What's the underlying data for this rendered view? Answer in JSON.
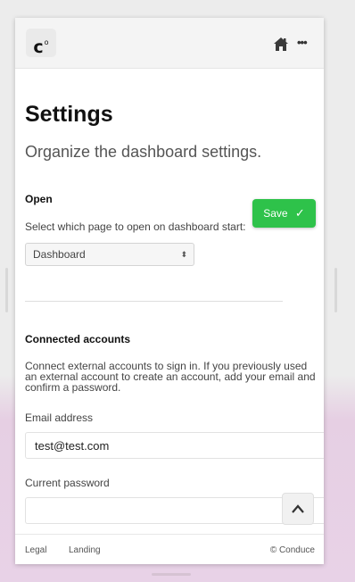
{
  "header": {
    "logo_text": "c",
    "logo_mark": "o",
    "home_icon": "home-icon",
    "more_icon": "more-options-icon",
    "more_glyph": "•••"
  },
  "page": {
    "title": "Settings",
    "subtitle": "Organize the dashboard settings."
  },
  "open_section": {
    "heading": "Open",
    "hint": "Select which page to open on dashboard start:",
    "select_value": "Dashboard",
    "select_arrows": "⬍"
  },
  "save_button": {
    "label": "Save",
    "icon": "checkmark-icon",
    "icon_glyph": "✓",
    "color": "#2ec24a"
  },
  "connected_accounts": {
    "heading": "Connected accounts",
    "description": "Connect external accounts to sign in. If you previously used an external account to create an account, add your email and confirm a password.",
    "email_label": "Email address",
    "email_value": "test@test.com",
    "password_label": "Current password",
    "password_value": ""
  },
  "scroll_top": {
    "icon": "chevron-up-icon"
  },
  "footer": {
    "links": [
      "Legal",
      "Landing"
    ],
    "copyright": "© Conduce"
  }
}
